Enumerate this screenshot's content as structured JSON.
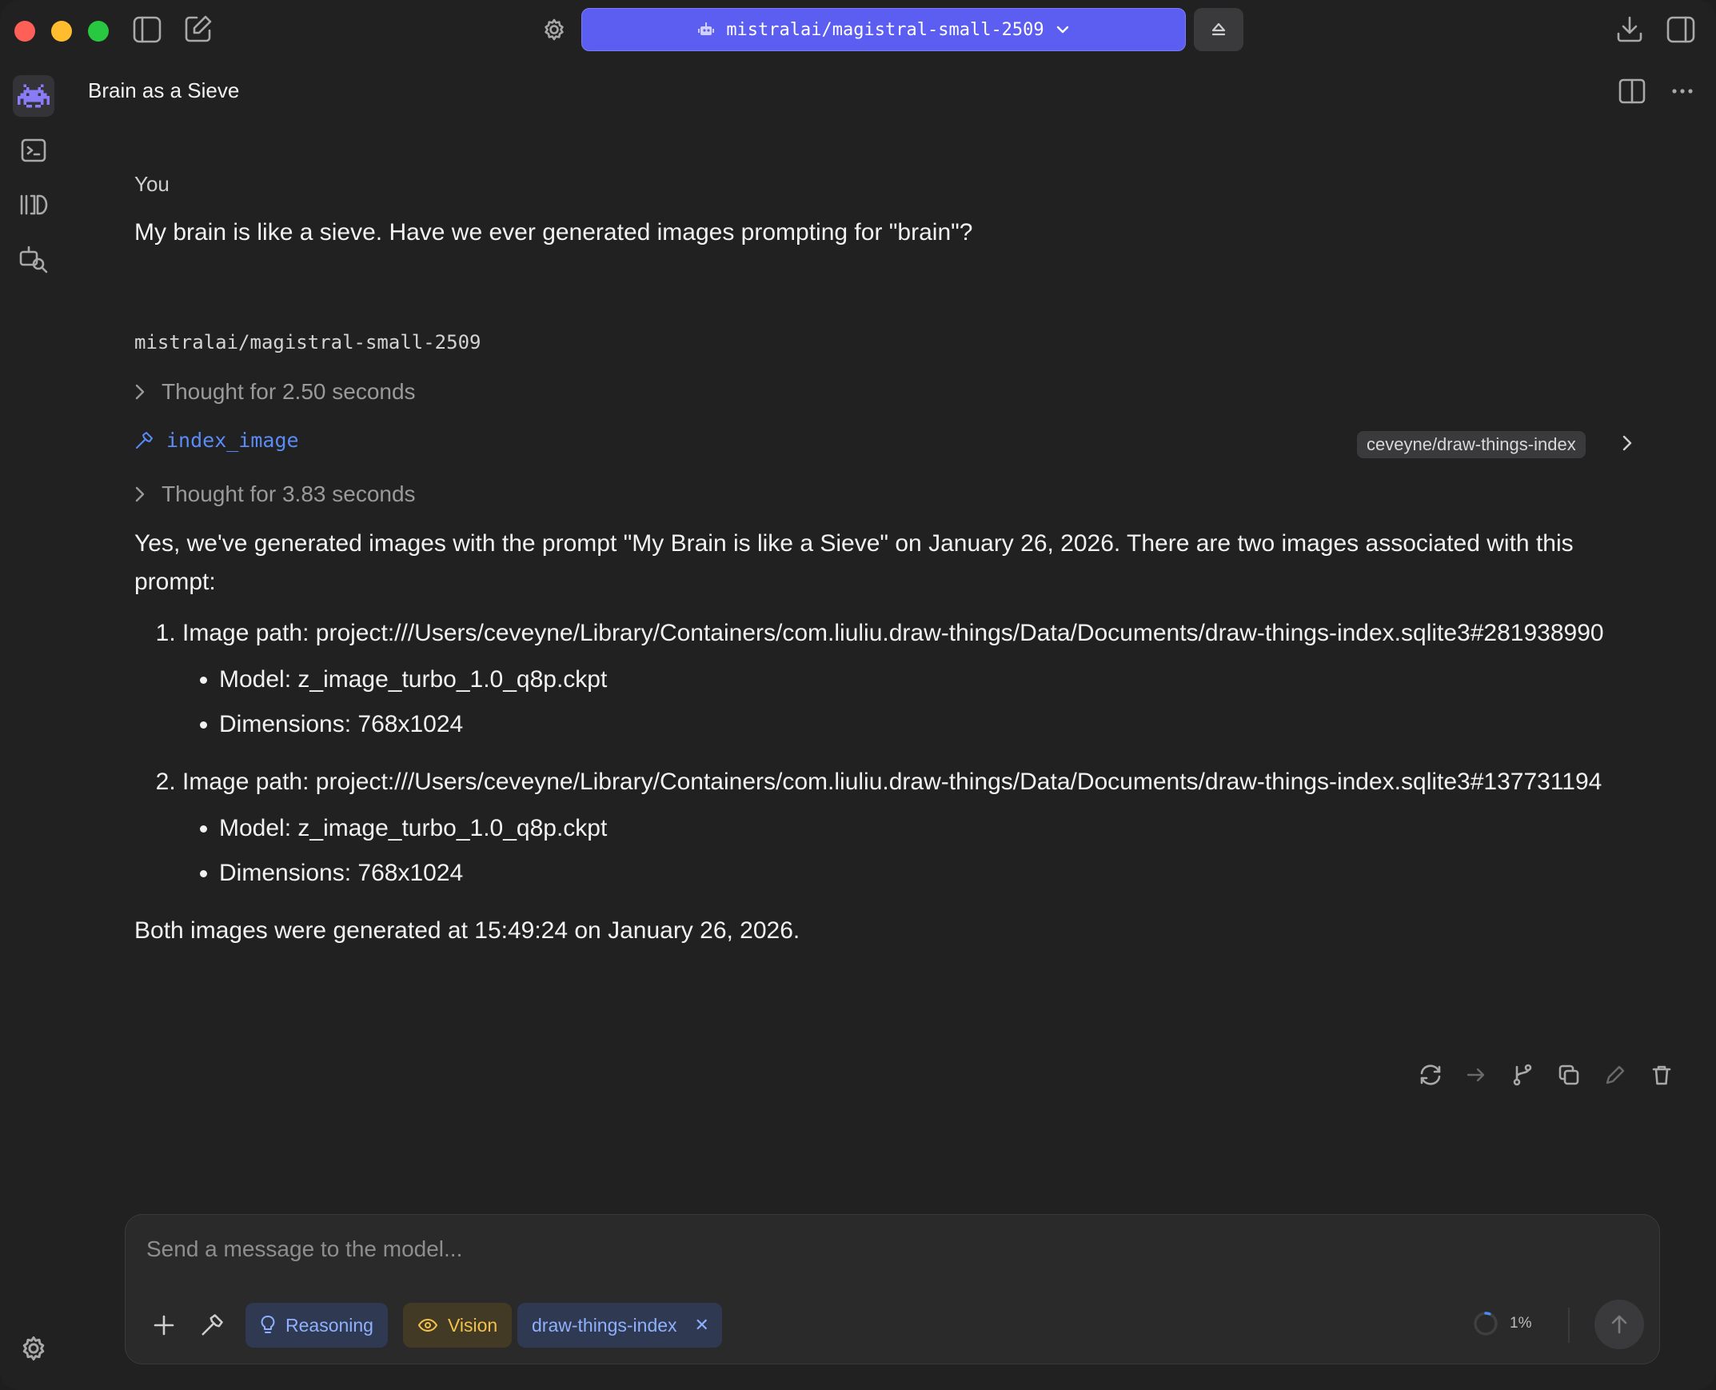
{
  "titlebar": {
    "model_name": "mistralai/magistral-small-2509",
    "model_icon": "robot-icon"
  },
  "conversation": {
    "title": "Brain as a Sieve"
  },
  "messages": {
    "user_label": "You",
    "user_text": "My brain is like a sieve. Have we ever generated images prompting for \"brain\"?",
    "model_label": "mistralai/magistral-small-2509",
    "thought1": "Thought for 2.50 seconds",
    "tool_name": "index_image",
    "tool_source": "ceveyne/draw-things-index",
    "thought2": "Thought for 3.83 seconds",
    "answer_intro": "Yes, we've generated images with the prompt \"My Brain is like a Sieve\" on January 26, 2026. There are two images associated with this prompt:",
    "images": [
      {
        "path_text": "Image path: project:///Users/ceveyne/Library/Containers/com.liuliu.draw-things/Data/Documents/draw-things-index.sqlite3#281938990",
        "model": "Model: z_image_turbo_1.0_q8p.ckpt",
        "dimensions": "Dimensions: 768x1024"
      },
      {
        "path_text": "Image path: project:///Users/ceveyne/Library/Containers/com.liuliu.draw-things/Data/Documents/draw-things-index.sqlite3#137731194",
        "model": "Model: z_image_turbo_1.0_q8p.ckpt",
        "dimensions": "Dimensions: 768x1024"
      }
    ],
    "answer_closing": "Both images were generated at 15:49:24 on January 26, 2026."
  },
  "composer": {
    "placeholder": "Send a message to the model...",
    "chips": {
      "reasoning": "Reasoning",
      "vision": "Vision",
      "plugin": "draw-things-index"
    },
    "context_usage": "1%",
    "context_fraction": 0.01
  },
  "colors": {
    "accent": "#5b5ef0",
    "background": "#212121",
    "tool_link": "#5b8bf7",
    "vision_chip": "#f2c14a",
    "reasoning_chip": "#8fb0ff"
  }
}
